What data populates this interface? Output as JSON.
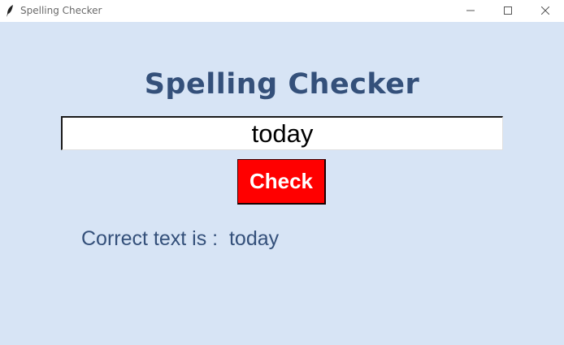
{
  "window": {
    "title": "Spelling Checker",
    "icon": "feather-icon",
    "controls": [
      "minimize-icon",
      "maximize-icon",
      "close-icon"
    ]
  },
  "app": {
    "heading": "Spelling Checker",
    "input_value": "today",
    "check_label": "Check",
    "result_prefix": "Correct text is :  ",
    "result_value": "today"
  },
  "colors": {
    "background": "#d7e4f5",
    "heading": "#34507a",
    "button": "#ff0000",
    "button_text": "#ffffff"
  }
}
